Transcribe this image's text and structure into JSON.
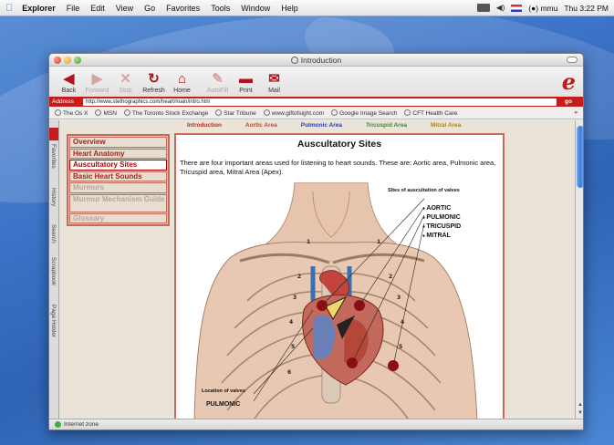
{
  "menubar": {
    "apple": "",
    "app_name": "Explorer",
    "items": [
      "File",
      "Edit",
      "View",
      "Go",
      "Favorites",
      "Tools",
      "Window",
      "Help"
    ],
    "clock": "Thu 3:22 PM",
    "keyboard_label": "(●) mmu"
  },
  "window": {
    "title": "Introduction"
  },
  "toolbar": {
    "buttons": [
      {
        "label": "Back",
        "icon": "back-arrow-icon",
        "glyph": "◀"
      },
      {
        "label": "Forward",
        "icon": "forward-arrow-icon",
        "glyph": "▶"
      },
      {
        "label": "Stop",
        "icon": "stop-x-icon",
        "glyph": "✕"
      },
      {
        "label": "Refresh",
        "icon": "refresh-icon",
        "glyph": "↻"
      },
      {
        "label": "Home",
        "icon": "home-icon",
        "glyph": "⌂"
      },
      {
        "label": "AutoFill",
        "icon": "autofill-pen-icon",
        "glyph": "✎"
      },
      {
        "label": "Print",
        "icon": "printer-icon",
        "glyph": "▬"
      },
      {
        "label": "Mail",
        "icon": "mail-icon",
        "glyph": "✉"
      }
    ],
    "logo_glyph": "e"
  },
  "addressbar": {
    "label": "Address",
    "url": "http://www.stethographics.com/heart/main/intro.htm",
    "go_label": "go"
  },
  "favorites": [
    "The Os X",
    "MSN",
    "The Toronto Stock Exchange",
    "Star Tribune",
    "www.giftofsight.com",
    "Google Image Search",
    "CFT Health Care"
  ],
  "sidebar_tabs": [
    "Favorites",
    "History",
    "Search",
    "Scrapbook",
    "Page Holder"
  ],
  "page": {
    "topnav": [
      {
        "label": "Introduction",
        "color": "#a43424"
      },
      {
        "label": "Aortic Area",
        "color": "#b0492e"
      },
      {
        "label": "Pulmonic Area",
        "color": "#2d3f9a"
      },
      {
        "label": "Tricuspid Area",
        "color": "#3c8a2a"
      },
      {
        "label": "Mitral Area",
        "color": "#a8822c"
      }
    ],
    "nav": [
      {
        "label": "Overview",
        "state": "normal"
      },
      {
        "label": "Heart Anatomy",
        "state": "normal"
      },
      {
        "label": "Auscultatory Sites",
        "state": "active"
      },
      {
        "label": "Basic Heart Sounds",
        "state": "normal"
      },
      {
        "label": "Murmurs",
        "state": "disabled"
      },
      {
        "label": "Murmur Mechanism Guide",
        "state": "disabled"
      },
      {
        "label": "Glossary",
        "state": "disabled"
      }
    ],
    "content": {
      "title": "Auscultatory Sites",
      "text": "There are four important areas used for listening to heart sounds. These are: Aortic area, Pulmonic area, Tricuspid area, Mitral Area (Apex).",
      "figure": {
        "legend_title": "Sites of auscultation of valves",
        "legend": [
          "AORTIC",
          "PULMONIC",
          "TRICUSPID",
          "MITRAL"
        ],
        "location_label": "Location of valves",
        "pulmonic_label": "PULMONIC",
        "rib_numbers": [
          "1",
          "1",
          "2",
          "2",
          "3",
          "3",
          "4",
          "4",
          "5",
          "5",
          "6"
        ],
        "dot_color": "#8b0f12"
      }
    }
  },
  "statusbar": {
    "text": "Internet zone"
  }
}
